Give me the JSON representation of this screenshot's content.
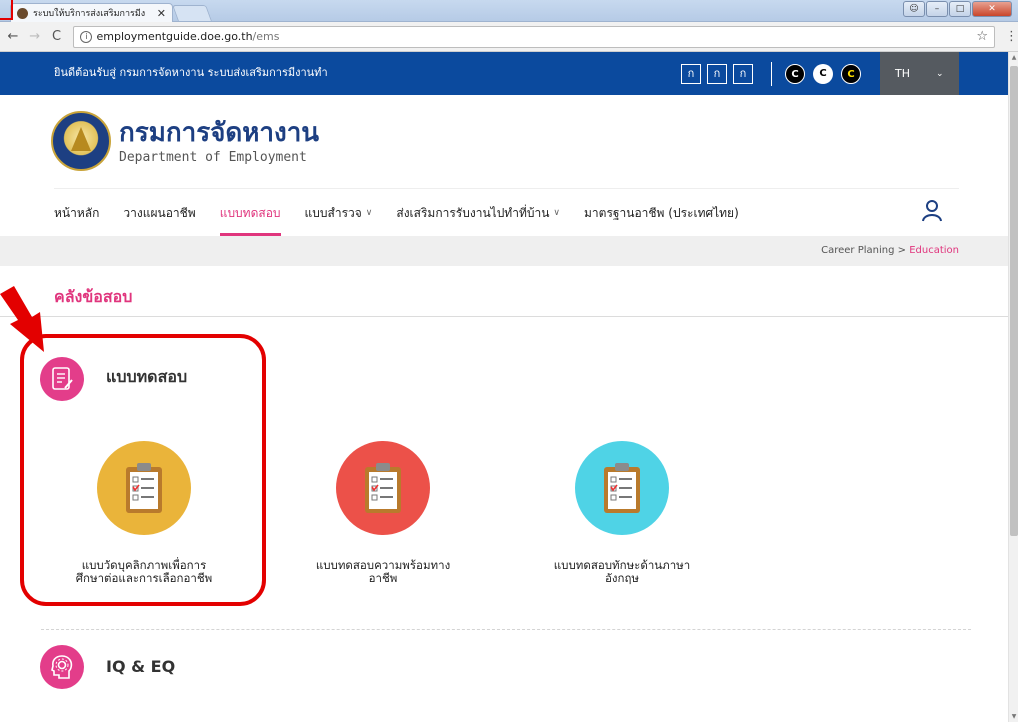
{
  "browser": {
    "tab_title": "ระบบให้บริการส่งเสริมการมีง",
    "tab_close": "✕",
    "url_host": "employmentguide.doe.go.th",
    "url_path": "/ems"
  },
  "topbar": {
    "welcome": "ยินดีต้อนรับสู่ กรมการจัดหางาน ระบบส่งเสริมการมีงานทำ",
    "font_sizes": [
      "ก",
      "ก",
      "ก"
    ],
    "contrast": [
      "C",
      "C",
      "C"
    ],
    "language": "TH"
  },
  "logo": {
    "thai": "กรมการจัดหางาน",
    "english": "Department of Employment"
  },
  "nav": {
    "items": [
      {
        "label": "หน้าหลัก",
        "dropdown": false
      },
      {
        "label": "วางแผนอาชีพ",
        "dropdown": false
      },
      {
        "label": "แบบทดสอบ",
        "dropdown": false,
        "active": true
      },
      {
        "label": "แบบสำรวจ",
        "dropdown": true
      },
      {
        "label": "ส่งเสริมการรับงานไปทำที่บ้าน",
        "dropdown": true
      },
      {
        "label": "มาตรฐานอาชีพ (ประเทศไทย)",
        "dropdown": false
      }
    ],
    "caret": "∨"
  },
  "breadcrumb": {
    "parent": "Career Planing",
    "separator": ">",
    "current": "Education"
  },
  "section": {
    "title": "คลังข้อสอบ"
  },
  "categories": {
    "tests": {
      "label": "แบบทดสอบ",
      "color": "#e33d8a",
      "items": [
        {
          "line1": "แบบวัดบุคลิกภาพเพื่อการ",
          "line2": "ศึกษาต่อและการเลือกอาชีพ",
          "color": "#eab43a"
        },
        {
          "line1": "แบบทดสอบความพร้อมทาง",
          "line2": "อาชีพ",
          "color": "#ec5149"
        },
        {
          "line1": "แบบทดสอบทักษะด้านภาษา",
          "line2": "อังกฤษ",
          "color": "#4fd3e6"
        }
      ]
    },
    "iq": {
      "label": "IQ & EQ"
    }
  }
}
